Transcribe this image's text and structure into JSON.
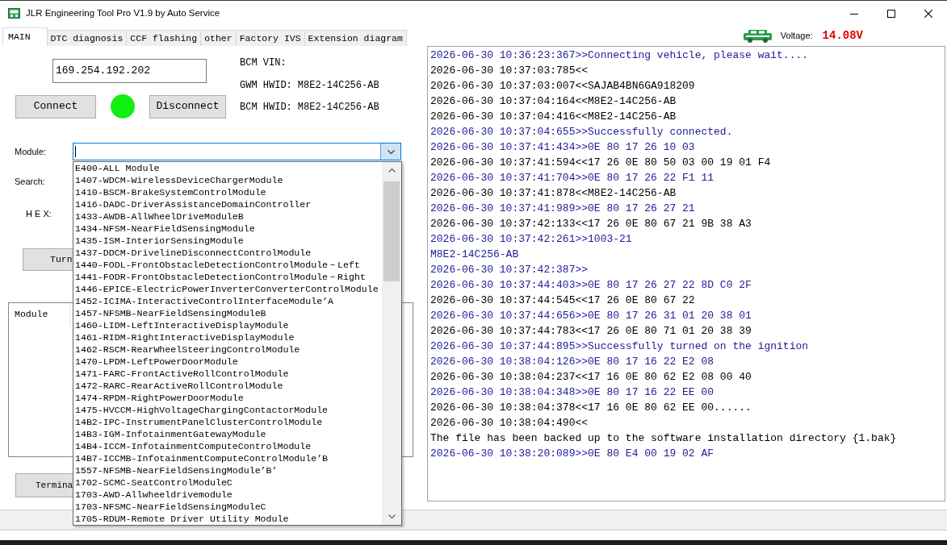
{
  "window": {
    "title": "JLR Engineering Tool Pro V1.9 by Auto Service"
  },
  "tabs": [
    {
      "label": "MAIN",
      "selected": true
    },
    {
      "label": "DTC diagnosis",
      "selected": false
    },
    {
      "label": "CCF flashing",
      "selected": false
    },
    {
      "label": "other",
      "selected": false
    },
    {
      "label": "Factory IVS",
      "selected": false
    },
    {
      "label": "Extension diagram",
      "selected": false
    }
  ],
  "voltage": {
    "label": "Voltage:",
    "value": "14.08V"
  },
  "connection": {
    "ip_address": "169.254.192.202",
    "connect_button": "Connect",
    "connected": true,
    "disconnect_button": "Disconnect"
  },
  "vehicle_info": [
    {
      "label": "BCM VIN:"
    },
    {
      "label": "GWM HWID:",
      "value": "M8E2-14C256-AB"
    },
    {
      "label": "BCM HWID:",
      "value": "M8E2-14C256-AB"
    }
  ],
  "module_select": {
    "label": "Module:",
    "expanded": true,
    "options": [
      "E400-ALL Module",
      "1407-WDCM-WirelessDeviceChargerModule",
      "1410-BSCM-BrakeSystemControlModule",
      "1416-DADC-DriverAssistanceDomainController",
      "1433-AWDB-AllWheelDriveModuleB",
      "1434-NFSM-NearFieldSensingModule",
      "1435-ISM-InteriorSensingModule",
      "1437-DDCM-DrivelineDisconnectControlModule",
      "1440-FODL-FrontObstacleDetectionControlModule－Left",
      "1441-FODR-FrontObstacleDetectionControlModule－Right",
      "1446-EPICE-ElectricPowerInverterConverterControlModule",
      "1452-ICIMA-InteractiveControlInterfaceModule’A",
      "1457-NFSMB-NearFieldSensingModuleB",
      "1460-LIDM-LeftInteractiveDisplayModule",
      "1461-RIDM-RightInteractiveDisplayModule",
      "1462-RSCM-RearWheelSteeringControlModule",
      "1470-LPDM-LeftPowerDoorModule",
      "1471-FARC-FrontActiveRollControlModule",
      "1472-RARC-RearActiveRollControlModule",
      "1474-RPDM-RightPowerDoorModule",
      "1475-HVCCM-HighVoltageChargingContactorModule",
      "14B2-IPC-InstrumentPanelClusterControlModule",
      "14B3-IGM-InfotainmentGatewayModule",
      "14B4-ICCM-InfotainmentComputeControlModule",
      "14B7-ICCMB-InfotainmentComputeControlModule’B",
      "1557-NFSMB-NearFieldSensingModule’B’",
      "1702-SCMC-SeatControlModuleC",
      "1703-AWD-Allwheeldrivemodule",
      "1703-NFSMC-NearFieldSensingModuleC",
      "1705-RDUM-Remote Driver Utility Module"
    ]
  },
  "search": {
    "label": "Search:"
  },
  "hex": {
    "label": "H E X:"
  },
  "partly_covered_buttons": [
    {
      "label": "Turn"
    },
    {
      "label": "Termina"
    }
  ],
  "module_table": {
    "columns": [
      "Module"
    ]
  },
  "log": [
    {
      "text": "2026-06-30 10:36:23:367>>Connecting vehicle, please wait....",
      "color": "#20209a"
    },
    {
      "text": "2026-06-30 10:37:03:785<<",
      "color": "#000000"
    },
    {
      "text": "2026-06-30 10:37:03:007<<SAJAB4BN6GA918209",
      "color": "#000000"
    },
    {
      "text": "2026-06-30 10:37:04:164<<M8E2-14C256-AB",
      "color": "#000000"
    },
    {
      "text": "2026-06-30 10:37:04:416<<M8E2-14C256-AB",
      "color": "#000000"
    },
    {
      "text": "2026-06-30 10:37:04:655>>Successfully connected.",
      "color": "#20209a"
    },
    {
      "text": "2026-06-30 10:37:41:434>>0E 80 17 26 10 03",
      "color": "#20209a"
    },
    {
      "text": "2026-06-30 10:37:41:594<<17 26 0E 80 50 03 00 19 01 F4",
      "color": "#000000"
    },
    {
      "text": "2026-06-30 10:37:41:704>>0E 80 17 26 22 F1 11",
      "color": "#20209a"
    },
    {
      "text": "2026-06-30 10:37:41:878<<M8E2-14C256-AB",
      "color": "#000000"
    },
    {
      "text": "2026-06-30 10:37:41:989>>0E 80 17 26 27 21",
      "color": "#20209a"
    },
    {
      "text": "2026-06-30 10:37:42:133<<17 26 0E 80 67 21 9B 38 A3",
      "color": "#000000"
    },
    {
      "text": "2026-06-30 10:37:42:261>>1003-21",
      "color": "#20209a"
    },
    {
      "text": "M8E2-14C256-AB",
      "color": "#20209a"
    },
    {
      "text": "2026-06-30 10:37:42:387>>",
      "color": "#20209a"
    },
    {
      "text": "2026-06-30 10:37:44:403>>0E 80 17 26 27 22 8D C0 2F",
      "color": "#20209a"
    },
    {
      "text": "2026-06-30 10:37:44:545<<17 26 0E 80 67 22",
      "color": "#000000"
    },
    {
      "text": "2026-06-30 10:37:44:656>>0E 80 17 26 31 01 20 38 01",
      "color": "#20209a"
    },
    {
      "text": "2026-06-30 10:37:44:783<<17 26 0E 80 71 01 20 38 39",
      "color": "#000000"
    },
    {
      "text": "2026-06-30 10:37:44:895>>Successfully turned on the ignition",
      "color": "#20209a"
    },
    {
      "text": "2026-06-30 10:38:04:126>>0E 80 17 16 22 E2 08",
      "color": "#20209a"
    },
    {
      "text": "2026-06-30 10:38:04:237<<17 16 0E 80 62 E2 08 00 40",
      "color": "#000000"
    },
    {
      "text": "2026-06-30 10:38:04:348>>0E 80 17 16 22 EE 00",
      "color": "#20209a"
    },
    {
      "text": "2026-06-30 10:38:04:378<<17 16 0E 80 62 EE 00......",
      "color": "#000000"
    },
    {
      "text": "2026-06-30 10:38:04:490<<",
      "color": "#000000"
    },
    {
      "text": "The file has been backed up to the software installation directory {1.bak}",
      "color": "#000000"
    },
    {
      "text": "2026-06-30 10:38:20:089>>0E 80 E4 00 19 02 AF",
      "color": "#20209a"
    }
  ]
}
